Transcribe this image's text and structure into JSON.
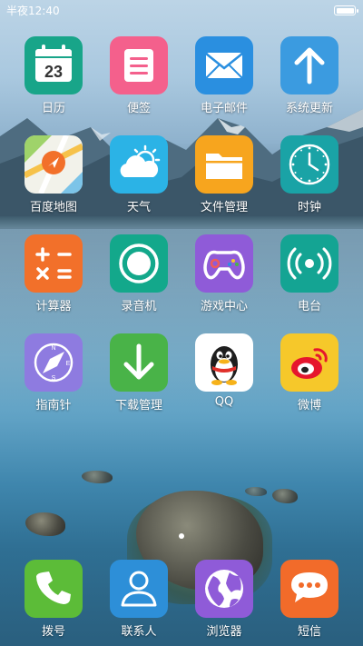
{
  "status_bar": {
    "time": "半夜12:40",
    "battery_icon": "battery-icon"
  },
  "apps": [
    {
      "label": "日历",
      "icon": "calendar-icon",
      "badge_text": "23",
      "color": "#18a589"
    },
    {
      "label": "便签",
      "icon": "notes-icon",
      "color": "#f4608c"
    },
    {
      "label": "电子邮件",
      "icon": "mail-icon",
      "color": "#2a8fe0"
    },
    {
      "label": "系统更新",
      "icon": "update-arrow-icon",
      "color": "#3b9be0"
    },
    {
      "label": "百度地图",
      "icon": "map-icon",
      "color": "#f2f2ea"
    },
    {
      "label": "天气",
      "icon": "weather-icon",
      "color": "#2bb3e6"
    },
    {
      "label": "文件管理",
      "icon": "folder-icon",
      "color": "#f7a51e"
    },
    {
      "label": "时钟",
      "icon": "clock-icon",
      "color": "#1aa3a6"
    },
    {
      "label": "计算器",
      "icon": "calculator-icon",
      "color": "#f2702a"
    },
    {
      "label": "录音机",
      "icon": "recorder-icon",
      "color": "#13a88b"
    },
    {
      "label": "游戏中心",
      "icon": "gamepad-icon",
      "color": "#8f5bd8"
    },
    {
      "label": "电台",
      "icon": "radio-icon",
      "color": "#14a493"
    },
    {
      "label": "指南针",
      "icon": "compass-icon",
      "color": "#8e7be0"
    },
    {
      "label": "下载管理",
      "icon": "download-icon",
      "color": "#49b348"
    },
    {
      "label": "QQ",
      "icon": "qq-penguin-icon",
      "color": "#ffffff"
    },
    {
      "label": "微博",
      "icon": "weibo-icon",
      "color": "#f6c82a"
    }
  ],
  "dock": [
    {
      "label": "拨号",
      "icon": "phone-icon",
      "color": "#5cbc38"
    },
    {
      "label": "联系人",
      "icon": "contacts-icon",
      "color": "#2d8fd8"
    },
    {
      "label": "浏览器",
      "icon": "browser-globe-icon",
      "color": "#8f5bd8"
    },
    {
      "label": "短信",
      "icon": "message-icon",
      "color": "#f26b2a"
    }
  ],
  "page_indicator": {
    "pages": 1,
    "current": 1
  }
}
